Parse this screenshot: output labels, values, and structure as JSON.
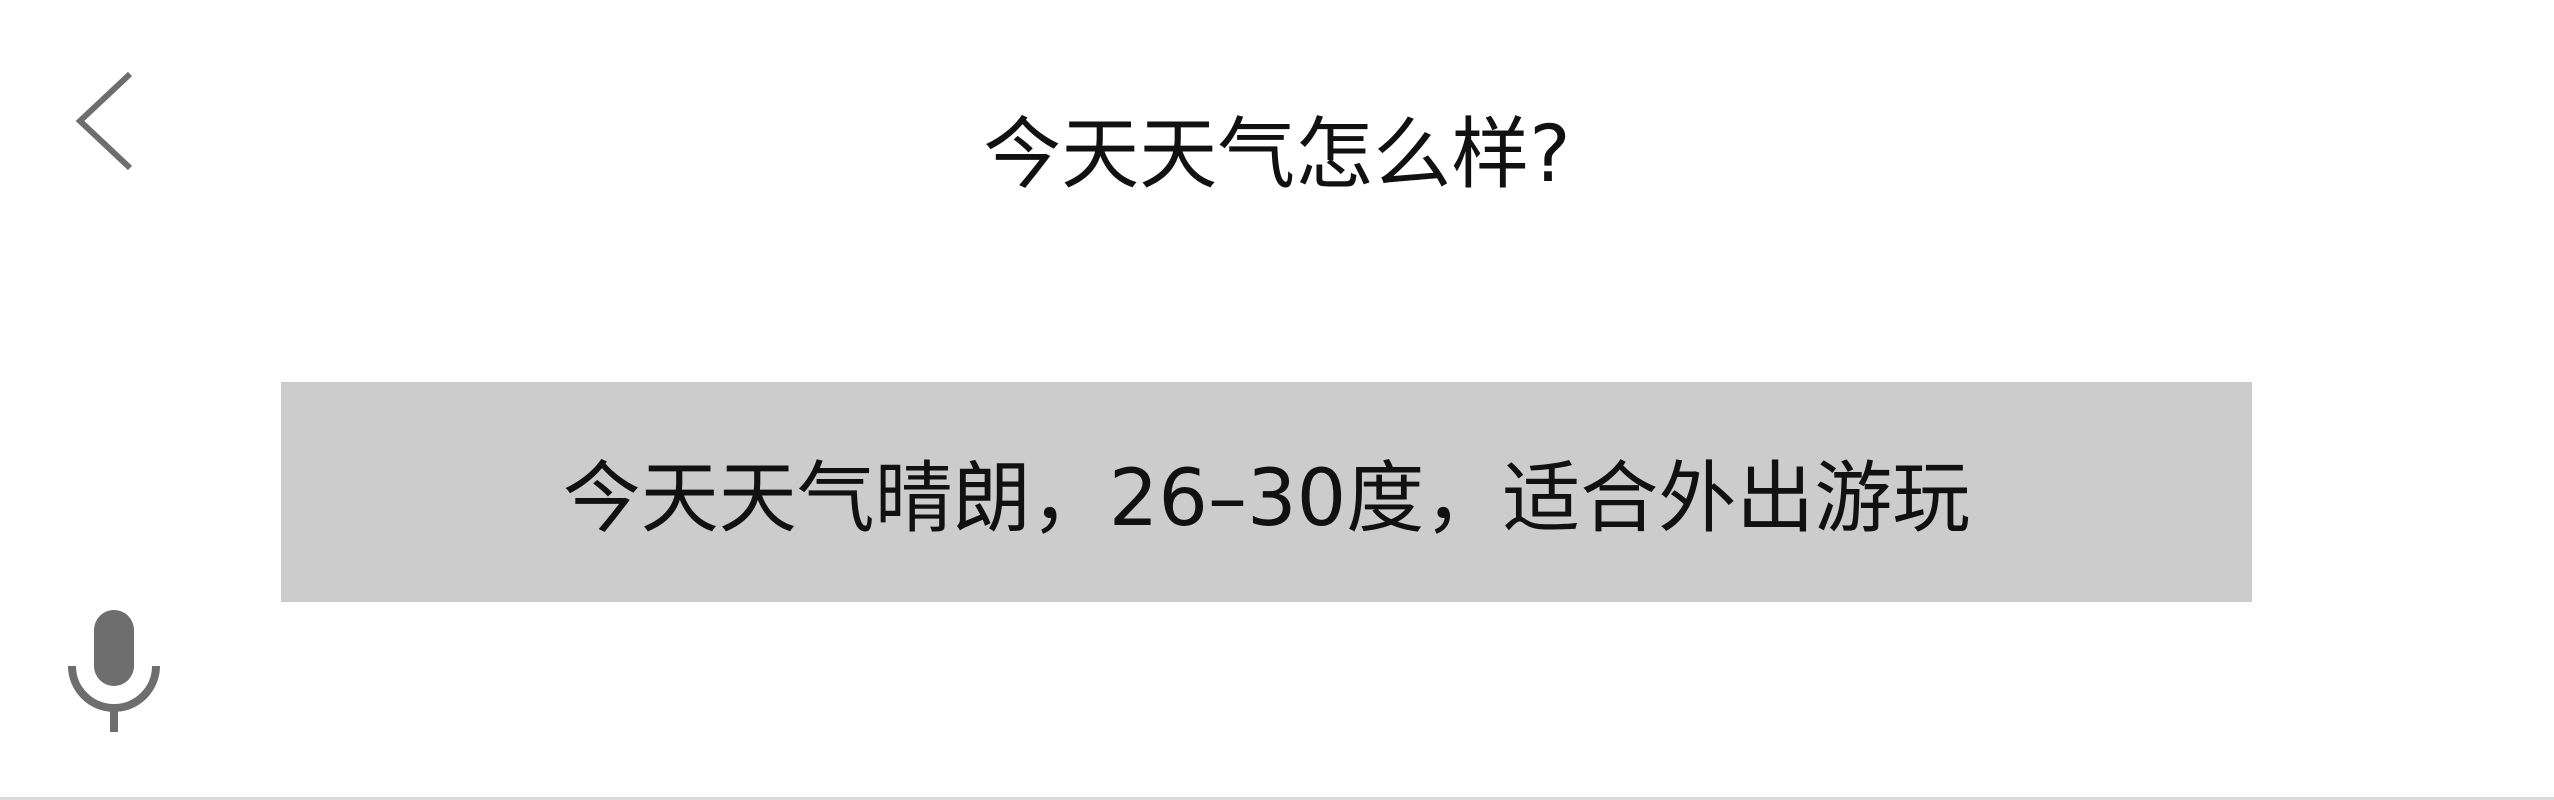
{
  "header": {
    "back_icon": "chevron-left-icon",
    "question": "今天天气怎么样?"
  },
  "answer": {
    "text": "今天天气晴朗，26–30度，适合外出游玩"
  },
  "footer": {
    "mic_icon": "microphone-icon"
  },
  "colors": {
    "background": "#ffffff",
    "answer_bg": "#cccccc",
    "icon_gray": "#6e6e6e",
    "text": "#111111",
    "divider": "#d9d9d9"
  }
}
